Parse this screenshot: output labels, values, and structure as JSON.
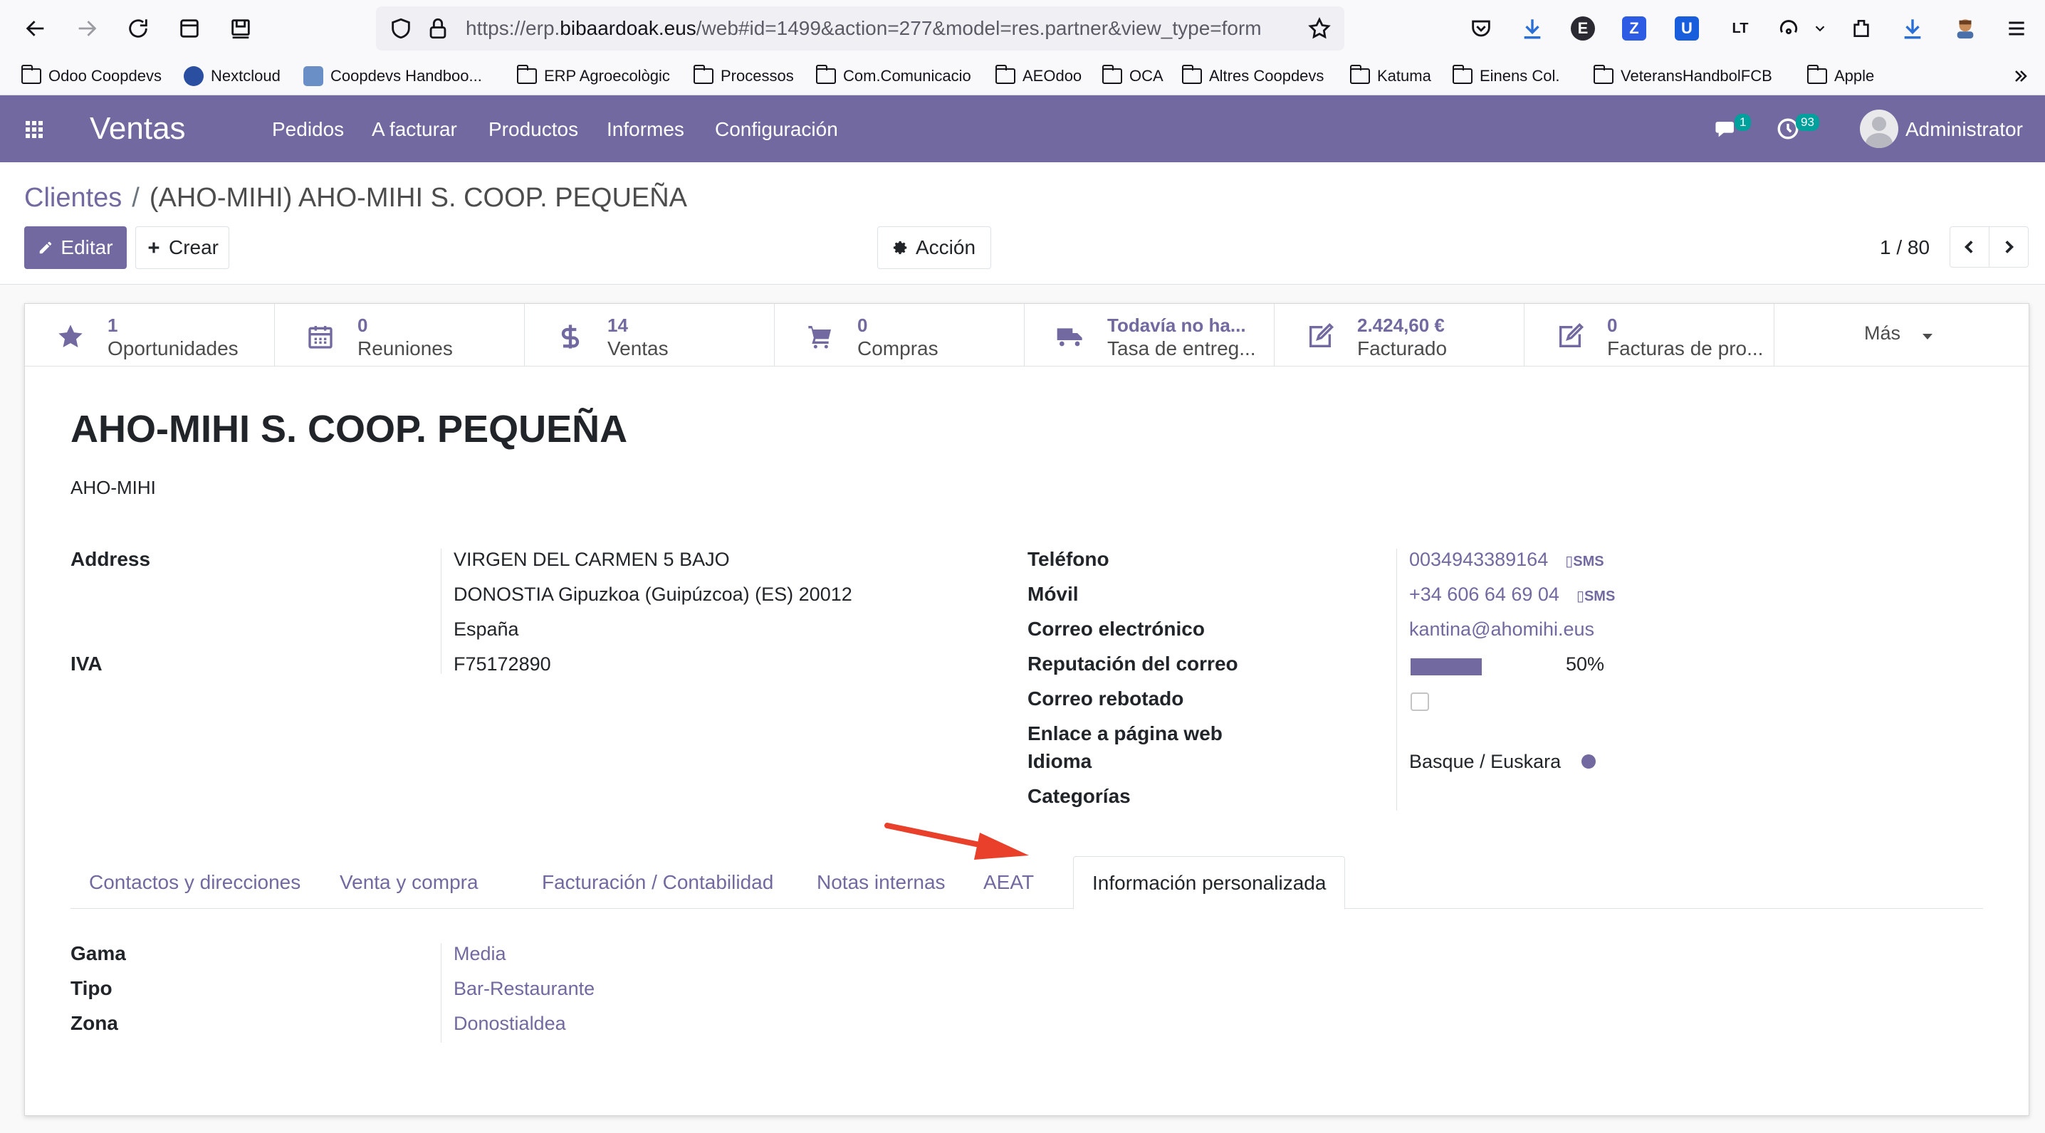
{
  "browser": {
    "url_prefix": "https://erp.",
    "url_domain": "bibaardoak.eus",
    "url_rest": "/web#id=1499&action=277&model=res.partner&view_type=form",
    "bookmarks": [
      "Odoo Coopdevs",
      "Nextcloud",
      "Coopdevs Handboo...",
      "ERP Agroecològic",
      "Processos",
      "Com.Comunicacio",
      "AEOdoo",
      "OCA",
      "Altres Coopdevs",
      "Katuma",
      "Einens Col.",
      "VeteransHandbolFCB",
      "Apple"
    ],
    "ext_labels": {
      "e": "E",
      "z": "Z",
      "u": "U",
      "lt": "LT"
    }
  },
  "navbar": {
    "app_name": "Ventas",
    "menus": [
      "Pedidos",
      "A facturar",
      "Productos",
      "Informes",
      "Configuración"
    ],
    "messages_count": "1",
    "activities_count": "93",
    "user_name": "Administrator"
  },
  "control_panel": {
    "breadcrumb_parent": "Clientes",
    "breadcrumb_separator": "/",
    "breadcrumb_current": "(AHO-MIHI) AHO-MIHI S. COOP. PEQUEÑA",
    "edit_label": "Editar",
    "create_label": "Crear",
    "action_label": "Acción",
    "pager_value": "1 / 80"
  },
  "stat_buttons": [
    {
      "icon": "star-icon",
      "value": "1",
      "label": "Oportunidades"
    },
    {
      "icon": "calendar-icon",
      "value": "0",
      "label": "Reuniones"
    },
    {
      "icon": "dollar-icon",
      "value": "14",
      "label": "Ventas"
    },
    {
      "icon": "cart-icon",
      "value": "0",
      "label": "Compras"
    },
    {
      "icon": "truck-icon",
      "value": "Todavía no ha...",
      "label": "Tasa de entreg..."
    },
    {
      "icon": "edit-icon",
      "value": "2.424,60 €",
      "label": "Facturado"
    },
    {
      "icon": "edit-icon",
      "value": "0",
      "label": "Facturas de pro..."
    }
  ],
  "more_label": "Más",
  "partner": {
    "name": "AHO-MIHI S. COOP. PEQUEÑA",
    "ref": "AHO-MIHI"
  },
  "left_fields": {
    "address_label": "Address",
    "street": "VIRGEN DEL CARMEN 5 BAJO",
    "city_line": "DONOSTIA  Gipuzkoa (Guipúzcoa) (ES)  20012",
    "country": "España",
    "vat_label": "IVA",
    "vat": "F75172890"
  },
  "right_fields": {
    "phone_label": "Teléfono",
    "phone": "0034943389164",
    "mobile_label": "Móvil",
    "mobile": "+34 606 64 69 04",
    "sms_label": "SMS",
    "email_label": "Correo electrónico",
    "email": "kantina@ahomihi.eus",
    "reputation_label": "Reputación del correo",
    "reputation_percent": "50%",
    "reputation_fraction": 0.5,
    "bounce_label": "Correo rebotado",
    "website_label": "Enlace a página web",
    "lang_label": "Idioma",
    "lang": "Basque / Euskara",
    "categories_label": "Categorías"
  },
  "tabs": [
    "Contactos y direcciones",
    "Venta y compra",
    "Facturación / Contabilidad",
    "Notas internas",
    "AEAT",
    "Información personalizada"
  ],
  "active_tab_index": 5,
  "custom_info": {
    "gama_label": "Gama",
    "gama": "Media",
    "tipo_label": "Tipo",
    "tipo": "Bar-Restaurante",
    "zona_label": "Zona",
    "zona": "Donostialdea"
  },
  "colors": {
    "brand": "#71699f",
    "annotation_arrow": "#e8402a"
  }
}
